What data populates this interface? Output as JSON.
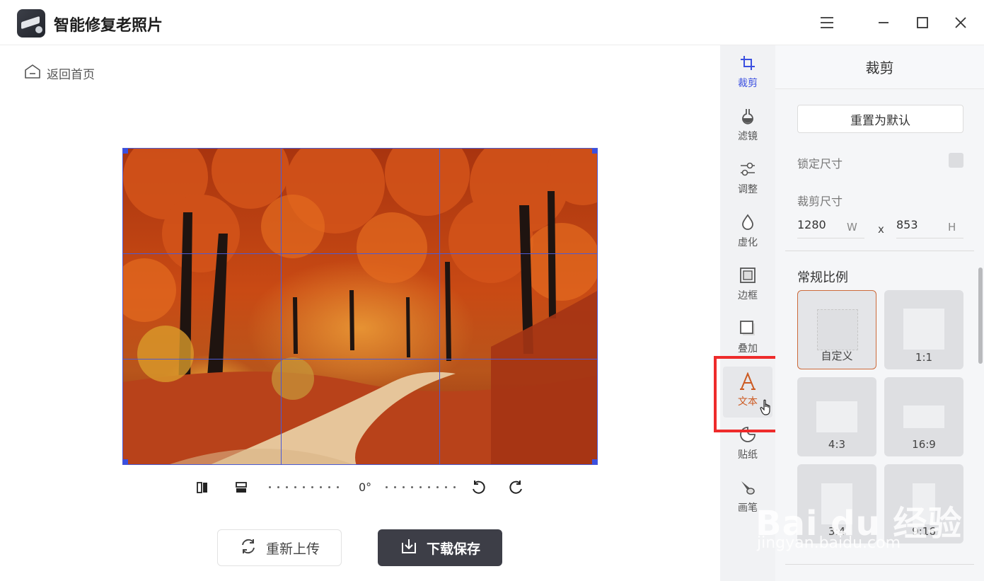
{
  "app": {
    "title": "智能修复老照片"
  },
  "window_controls": {
    "menu_icon": "menu-icon",
    "min_icon": "minimize-icon",
    "max_icon": "maximize-icon",
    "close_icon": "close-icon"
  },
  "nav": {
    "back_label": "返回首页"
  },
  "editor": {
    "rotation_value": "0°",
    "reupload_label": "重新上传",
    "download_label": "下载保存"
  },
  "tools": [
    {
      "label": "裁剪",
      "icon": "crop-icon",
      "state": "active"
    },
    {
      "label": "滤镜",
      "icon": "filter-flask-icon",
      "state": "normal"
    },
    {
      "label": "调整",
      "icon": "adjust-slider-icon",
      "state": "normal"
    },
    {
      "label": "虚化",
      "icon": "blur-drop-icon",
      "state": "normal"
    },
    {
      "label": "边框",
      "icon": "frame-icon",
      "state": "normal"
    },
    {
      "label": "叠加",
      "icon": "overlay-icon",
      "state": "normal"
    },
    {
      "label": "文本",
      "icon": "text-a-icon",
      "state": "hovered"
    },
    {
      "label": "贴纸",
      "icon": "sticker-icon",
      "state": "normal"
    },
    {
      "label": "画笔",
      "icon": "brush-icon",
      "state": "normal"
    }
  ],
  "panel": {
    "title": "裁剪",
    "reset_label": "重置为默认",
    "lock_label": "锁定尺寸",
    "lock_checked": false,
    "crop_size_label": "裁剪尺寸",
    "width_value": "1280",
    "width_unit": "W",
    "times": "x",
    "height_value": "853",
    "height_unit": "H",
    "ratio_section": "常规比例",
    "ratios": [
      {
        "label": "自定义",
        "selected": true
      },
      {
        "label": "1:1",
        "selected": false
      },
      {
        "label": "4:3",
        "selected": false
      },
      {
        "label": "16:9",
        "selected": false
      },
      {
        "label": "3:4",
        "selected": false
      },
      {
        "label": "9:16",
        "selected": false
      }
    ]
  },
  "watermark": {
    "main": "Bai du 经验",
    "sub": "jingyan.baidu.com"
  },
  "colors": {
    "accent_blue": "#3a4fe0",
    "dark_button": "#3d3e47",
    "highlight_red": "#ee2b2b",
    "selected_border": "#cc6a3a"
  }
}
